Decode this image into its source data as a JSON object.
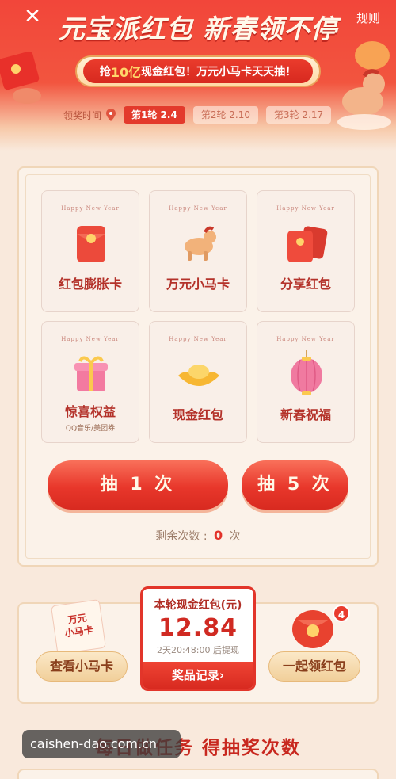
{
  "header": {
    "close_glyph": "✕",
    "rules_label": "规则",
    "title": "元宝派红包 新春领不停",
    "banner_prefix": "抢",
    "banner_highlight": "10亿",
    "banner_suffix": "现金红包！万元小马卡天天抽！",
    "award_time_label": "领奖时间",
    "rounds": [
      {
        "label": "第1轮 2.4",
        "active": true
      },
      {
        "label": "第2轮 2.10",
        "active": false
      },
      {
        "label": "第3轮 2.17",
        "active": false
      }
    ]
  },
  "prizes": [
    {
      "hny": "Happy New Year",
      "name": "红包膨胀卡",
      "sub": "",
      "icon": "red-envelope-icon"
    },
    {
      "hny": "Happy New Year",
      "name": "万元小马卡",
      "sub": "",
      "icon": "horse-icon"
    },
    {
      "hny": "Happy New Year",
      "name": "分享红包",
      "sub": "",
      "icon": "red-envelopes-icon"
    },
    {
      "hny": "Happy New Year",
      "name": "惊喜权益",
      "sub": "QQ音乐/美团券",
      "icon": "gift-box-icon"
    },
    {
      "hny": "Happy New Year",
      "name": "现金红包",
      "sub": "",
      "icon": "gold-ingot-icon"
    },
    {
      "hny": "Happy New Year",
      "name": "新春祝福",
      "sub": "",
      "icon": "lantern-icon"
    }
  ],
  "draw": {
    "draw_one_label": "抽 1 次",
    "draw_five_label": "抽 5 次",
    "remain_prefix": "剩余次数 : ",
    "remain_count": "0",
    "remain_suffix": " 次"
  },
  "cash": {
    "title": "本轮现金红包(元)",
    "amount": "12.84",
    "note": "2天20:48:00 后提现",
    "record_label": "奖品记录›"
  },
  "side": {
    "horse_card_text_1": "万元",
    "horse_card_text_2": "小马卡",
    "view_horse_label": "查看小马卡",
    "collect_label": "一起领红包",
    "badge_count": "4"
  },
  "tasks": {
    "title": "每日做任务 得抽奖次数"
  },
  "watermark": "caishen-dao.com.cn",
  "colors": {
    "primary_red": "#e33a2c",
    "gold": "#ffd76b",
    "bg": "#f9e9dc"
  }
}
